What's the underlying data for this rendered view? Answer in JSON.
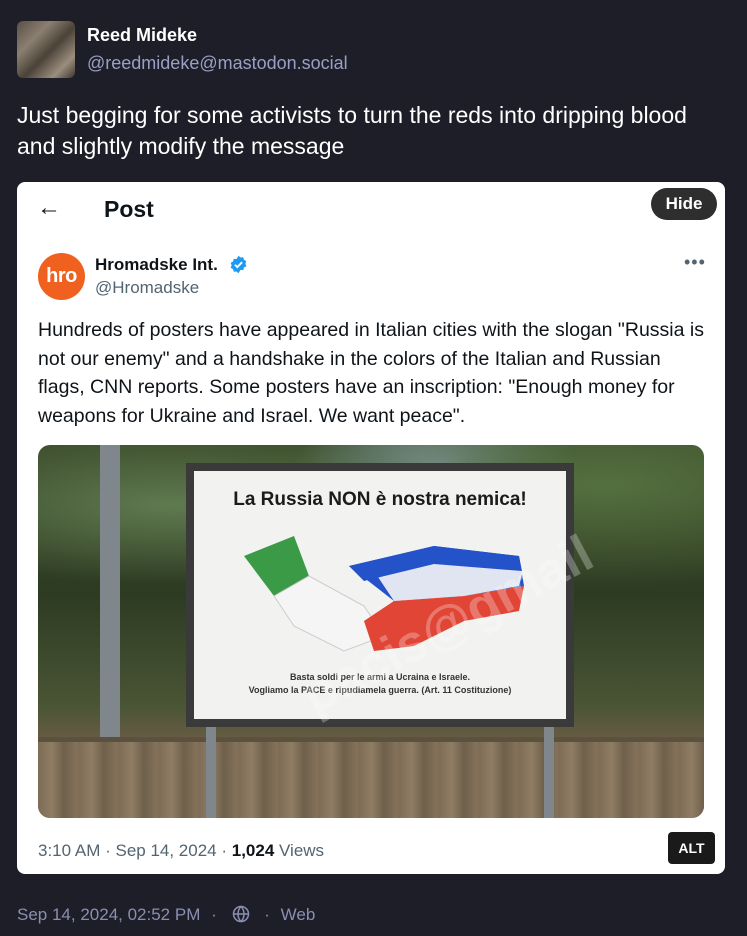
{
  "status": {
    "author_name": "Reed Mideke",
    "author_handle": "@reedmideke@mastodon.social",
    "text": "Just begging for some activists to turn the reds into dripping blood and slightly modify the message",
    "date": "Sep 14, 2024, 02:52 PM",
    "separator": "·",
    "visibility_icon": "globe-icon",
    "client": "Web"
  },
  "embed": {
    "back_icon": "arrow-left-icon",
    "back_glyph": "←",
    "header_title": "Post",
    "hide_label": "Hide",
    "tweet": {
      "avatar_text": "hro",
      "name": "Hromadske Int.",
      "handle": "@Hromadske",
      "more_glyph": "•••",
      "text": "Hundreds of posters have appeared in Italian cities with the slogan \"Russia is not our enemy\" and a handshake in the colors of the Italian and Russian flags, CNN reports. Some posters have an inscription: \"Enough money for weapons for Ukraine and Israel. We want peace\".",
      "time": "3:10 AM · Sep 14, 2024 · ",
      "views_count": "1,024",
      "views_label": " Views",
      "alt_label": "ALT"
    },
    "photo": {
      "poster_slogan": "La Russia NON è nostra nemica!",
      "poster_fine_line1": "Basta soldi per le armi a Ucraina e Israele.",
      "poster_fine_line2": "Vogliamo la PACE e ripudiamela guerra. (Art. 11 Costituzione)",
      "watermark": "pacis@gmail"
    }
  },
  "colors": {
    "background": "#1e1e29",
    "accent_handle": "#9aa0c4",
    "hro_orange": "#f0601e",
    "verified_blue": "#1d9bf0"
  }
}
